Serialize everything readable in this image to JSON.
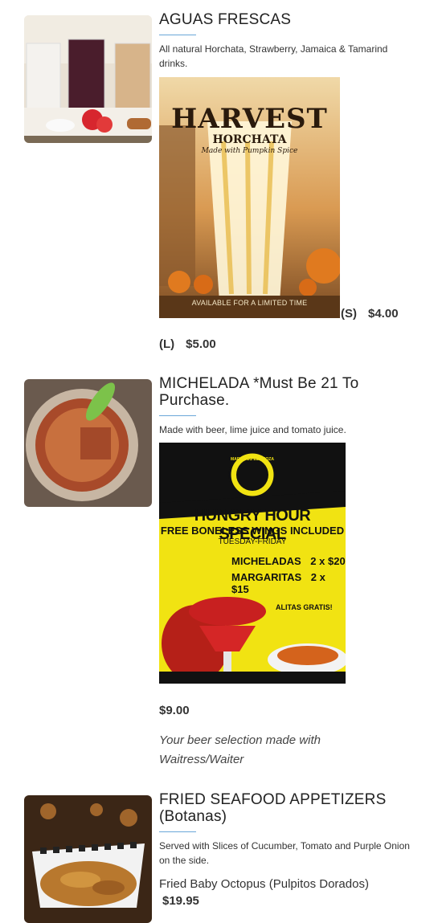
{
  "items": [
    {
      "title": "AGUAS FRESCAS",
      "description": "All natural Horchata, Strawberry, Jamaica & Tamarind drinks.",
      "poster": {
        "headline": "HARVEST",
        "subhead": "HORCHATA",
        "tagline": "Made with Pumpkin Spice",
        "footer": "AVAILABLE FOR A LIMITED TIME"
      },
      "prices": [
        {
          "size": "(S)",
          "price": "$4.00"
        },
        {
          "size": "(L)",
          "price": "$5.00"
        }
      ]
    },
    {
      "title": "MICHELADA *Must Be 21 To Purchase.",
      "description": "Made with beer, lime juice and tomato juice.",
      "poster": {
        "logo": "MARISCOS ESPINOZA",
        "headline": "HUNGRY HOUR SPECIAL",
        "subhead": "FREE BONELESS WINGS INCLUDED",
        "days": "TUESDAY-FRIDAY",
        "line1_name": "MICHELADAS",
        "line1_price": "2 x $20",
        "line2_name": "MARGARITAS",
        "line2_price": "2 x $15",
        "extra": "ALITAS GRATIS!"
      },
      "price": "$9.00",
      "note": "Your beer selection made with Waitress/Waiter"
    },
    {
      "title": "FRIED SEAFOOD APPETIZERS (Botanas)",
      "description": "Served with Slices of Cucumber, Tomato and Purple Onion on the side.",
      "option_name": "Fried Baby Octopus (Pulpitos Dorados)",
      "option_price": "$19.95"
    }
  ]
}
